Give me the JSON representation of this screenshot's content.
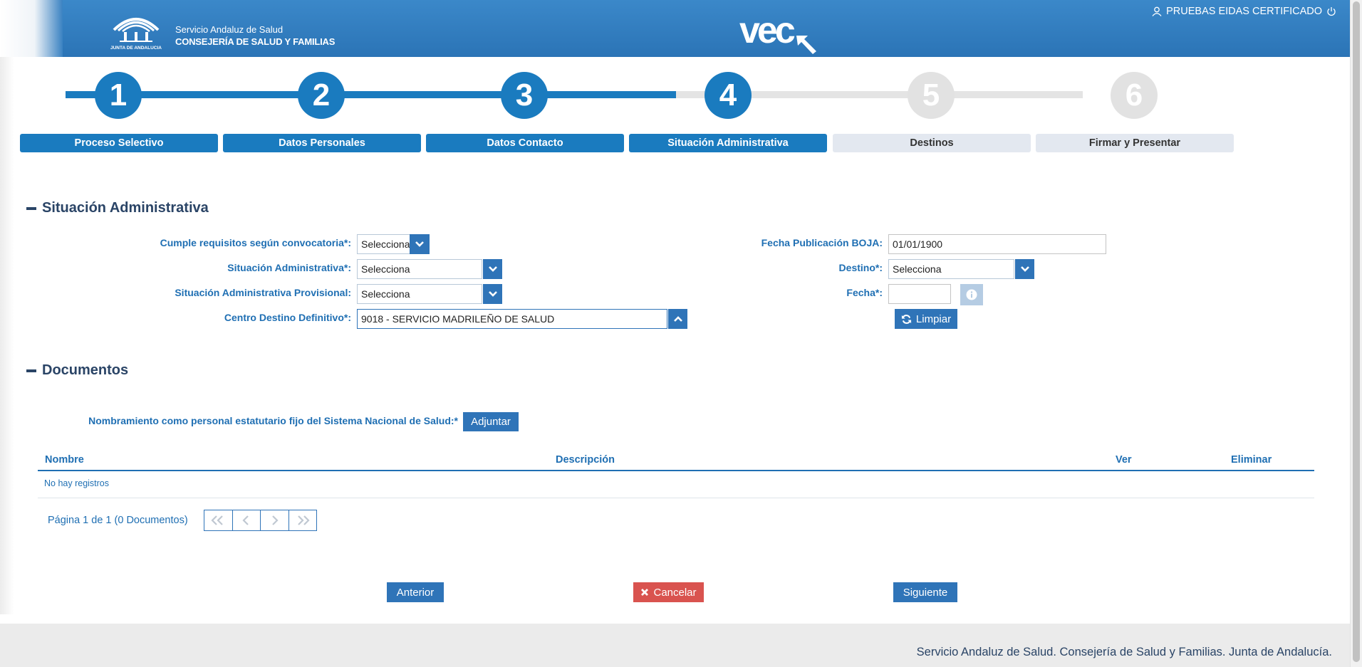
{
  "header": {
    "org_line1": "Servicio Andaluz de Salud",
    "org_line2": "CONSEJERÍA DE SALUD Y FAMILIAS",
    "org_logo_text": "JUNTA DE ANDALUCIA",
    "brand": "vec",
    "user": "PRUEBAS EIDAS CERTIFICADO",
    "user_icon": "user-icon",
    "logout_icon": "power-icon"
  },
  "wizard": {
    "steps": [
      {
        "number": "1",
        "label": "Proceso Selectivo",
        "state": "completed"
      },
      {
        "number": "2",
        "label": "Datos Personales",
        "state": "completed"
      },
      {
        "number": "3",
        "label": "Datos Contacto",
        "state": "completed"
      },
      {
        "number": "4",
        "label": "Situación Administrativa",
        "state": "current"
      },
      {
        "number": "5",
        "label": "Destinos",
        "state": "pending"
      },
      {
        "number": "6",
        "label": "Firmar y Presentar",
        "state": "pending"
      }
    ]
  },
  "situacion": {
    "title": "Situación Administrativa",
    "cumple_label": "Cumple requisitos según convocatoria*:",
    "cumple_value": "Selecciona",
    "situacion_label": "Situación Administrativa*:",
    "situacion_value": "Selecciona",
    "provisional_label": "Situación Administrativa Provisional:",
    "provisional_value": "Selecciona",
    "centro_label": "Centro Destino Definitivo*:",
    "centro_value": "9018 - SERVICIO MADRILEÑO DE SALUD",
    "fecha_boja_label": "Fecha Publicación BOJA:",
    "fecha_boja_value": "01/01/1900",
    "destino_label": "Destino*:",
    "destino_value": "Selecciona",
    "fecha_label": "Fecha*:",
    "fecha_value": "",
    "limpiar_label": "Limpiar"
  },
  "documentos": {
    "title": "Documentos",
    "nombramiento_label": "Nombramiento como personal estatutario fijo del Sistema Nacional de Salud:*",
    "adjuntar_label": "Adjuntar",
    "columns": {
      "nombre": "Nombre",
      "descripcion": "Descripción",
      "ver": "Ver",
      "eliminar": "Eliminar"
    },
    "empty_text": "No hay registros",
    "page_info": "Página 1 de 1 (0 Documentos)"
  },
  "actions": {
    "anterior": "Anterior",
    "cancelar": "Cancelar",
    "siguiente": "Siguiente"
  },
  "footer": {
    "text": "Servicio Andaluz de Salud. Consejería de Salud y Familias. Junta de Andalucía."
  },
  "colors": {
    "primary": "#1a7bbf",
    "header": "#2f7ac0",
    "cancel": "#d9534f",
    "pending": "#e2e2e2"
  }
}
